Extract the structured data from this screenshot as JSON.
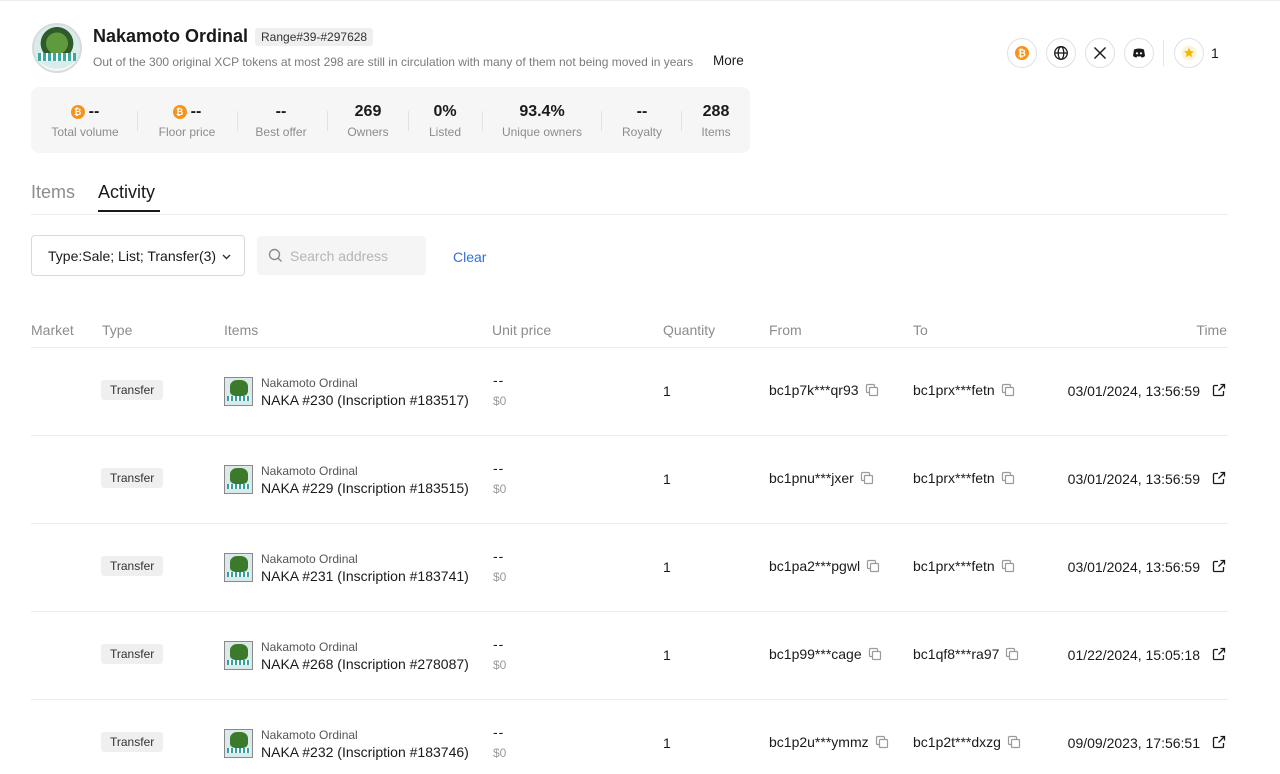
{
  "collection": {
    "name": "Nakamoto Ordinal",
    "range": "Range#39-#297628",
    "description": "Out of the 300 original XCP tokens at most 298 are still in circulation with many of them not being moved in years",
    "more_label": "More",
    "favorites_count": "1"
  },
  "social_icons": [
    "bitcoin-icon",
    "globe-icon",
    "x-icon",
    "discord-icon"
  ],
  "stats": [
    {
      "value": "--",
      "label": "Total volume",
      "btc": true
    },
    {
      "value": "--",
      "label": "Floor price",
      "btc": true
    },
    {
      "value": "--",
      "label": "Best offer",
      "btc": false
    },
    {
      "value": "269",
      "label": "Owners",
      "btc": false
    },
    {
      "value": "0%",
      "label": "Listed",
      "btc": false
    },
    {
      "value": "93.4%",
      "label": "Unique owners",
      "btc": false
    },
    {
      "value": "--",
      "label": "Royalty",
      "btc": false
    },
    {
      "value": "288",
      "label": "Items",
      "btc": false
    }
  ],
  "tabs": [
    {
      "label": "Items",
      "active": false
    },
    {
      "label": "Activity",
      "active": true
    }
  ],
  "filters": {
    "type_value": "Type:Sale; List; Transfer(3)",
    "search_placeholder": "Search address",
    "clear_label": "Clear"
  },
  "table": {
    "headers": [
      "Market",
      "Type",
      "Items",
      "Unit price",
      "Quantity",
      "From",
      "To",
      "Time"
    ],
    "rows": [
      {
        "type": "Transfer",
        "collection": "Nakamoto Ordinal",
        "item": "NAKA #230 (Inscription #183517)",
        "price": "--",
        "usd": "$0",
        "quantity": "1",
        "from": "bc1p7k***qr93",
        "to": "bc1prx***fetn",
        "time": "03/01/2024, 13:56:59"
      },
      {
        "type": "Transfer",
        "collection": "Nakamoto Ordinal",
        "item": "NAKA #229 (Inscription #183515)",
        "price": "--",
        "usd": "$0",
        "quantity": "1",
        "from": "bc1pnu***jxer",
        "to": "bc1prx***fetn",
        "time": "03/01/2024, 13:56:59"
      },
      {
        "type": "Transfer",
        "collection": "Nakamoto Ordinal",
        "item": "NAKA #231 (Inscription #183741)",
        "price": "--",
        "usd": "$0",
        "quantity": "1",
        "from": "bc1pa2***pgwl",
        "to": "bc1prx***fetn",
        "time": "03/01/2024, 13:56:59"
      },
      {
        "type": "Transfer",
        "collection": "Nakamoto Ordinal",
        "item": "NAKA #268 (Inscription #278087)",
        "price": "--",
        "usd": "$0",
        "quantity": "1",
        "from": "bc1p99***cage",
        "to": "bc1qf8***ra97",
        "time": "01/22/2024, 15:05:18"
      },
      {
        "type": "Transfer",
        "collection": "Nakamoto Ordinal",
        "item": "NAKA #232 (Inscription #183746)",
        "price": "--",
        "usd": "$0",
        "quantity": "1",
        "from": "bc1p2u***ymmz",
        "to": "bc1p2t***dxzg",
        "time": "09/09/2023, 17:56:51"
      }
    ]
  },
  "colors": {
    "accent_link": "#2f6fdc",
    "btc_orange": "#f7931a",
    "favorite_star": "#f5b400"
  }
}
